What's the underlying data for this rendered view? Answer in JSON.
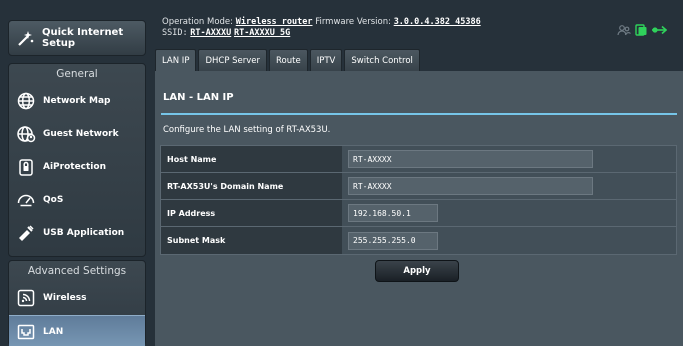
{
  "sidebar": {
    "quick_setup_label": "Quick Internet Setup",
    "general_title": "General",
    "general_items": [
      {
        "label": "Network Map"
      },
      {
        "label": "Guest Network"
      },
      {
        "label": "AiProtection"
      },
      {
        "label": "QoS"
      },
      {
        "label": "USB Application"
      }
    ],
    "advanced_title": "Advanced Settings",
    "advanced_items": [
      {
        "label": "Wireless"
      },
      {
        "label": "LAN",
        "active": true
      }
    ]
  },
  "topbar": {
    "op_mode_label": "Operation Mode:",
    "op_mode_value": "Wireless router",
    "firmware_label": "Firmware Version:",
    "firmware_value": "3.0.0.4.382_45386",
    "ssid_label": "SSID:",
    "ssid_1": "RT-AXXXU",
    "ssid_2": "RT-AXXXU_5G"
  },
  "tabs": [
    {
      "label": "LAN IP",
      "active": true
    },
    {
      "label": "DHCP Server"
    },
    {
      "label": "Route"
    },
    {
      "label": "IPTV"
    },
    {
      "label": "Switch Control"
    }
  ],
  "content": {
    "title": "LAN - LAN IP",
    "description": "Configure the LAN setting of RT-AX53U.",
    "fields": [
      {
        "label": "Host Name",
        "value": "RT-AXXXX"
      },
      {
        "label": "RT-AX53U's Domain Name",
        "value": "RT-AXXXX"
      },
      {
        "label": "IP Address",
        "value": "192.168.50.1"
      },
      {
        "label": "Subnet Mask",
        "value": "255.255.255.0"
      }
    ],
    "apply_label": "Apply"
  },
  "colors": {
    "background": "#26313a",
    "panel": "#4a5760",
    "accent_line": "#76c5e8",
    "active_nav": "#6d8cab",
    "status_green": "#2fd15b"
  }
}
